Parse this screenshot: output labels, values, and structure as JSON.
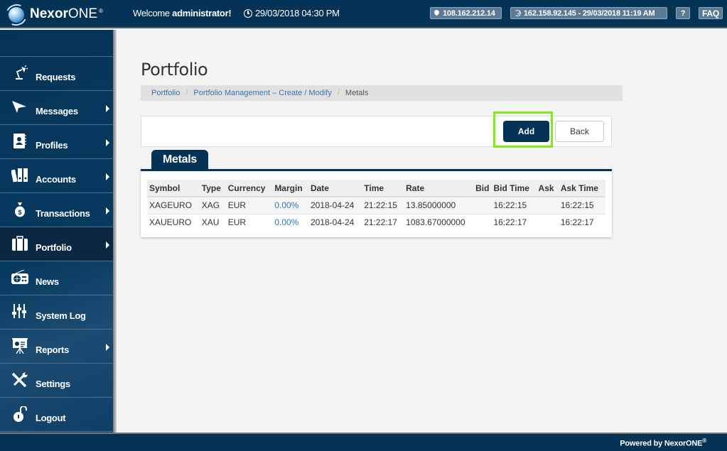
{
  "header": {
    "brand_bold": "Nexor",
    "brand_light": "ONE",
    "brand_mark": "®",
    "welcome_prefix": "Welcome ",
    "welcome_user": "administrator!",
    "datetime": "29/03/2018 04:30 PM",
    "ip_address": "108.162.212.14",
    "last_login": "162.158.92.145 - 29/03/2018 11:19 AM",
    "help_label": "?",
    "faq_label": "FAQ"
  },
  "sidebar": {
    "items": [
      {
        "label": "Requests",
        "icon": "desk-lamp-icon",
        "has_submenu": false
      },
      {
        "label": "Messages",
        "icon": "paper-plane-icon",
        "has_submenu": true
      },
      {
        "label": "Profiles",
        "icon": "address-book-icon",
        "has_submenu": true
      },
      {
        "label": "Accounts",
        "icon": "binders-icon",
        "has_submenu": true
      },
      {
        "label": "Transactions",
        "icon": "money-bag-icon",
        "has_submenu": true
      },
      {
        "label": "Portfolio",
        "icon": "briefcase-icon",
        "has_submenu": true,
        "active": true
      },
      {
        "label": "News",
        "icon": "radio-icon",
        "has_submenu": false
      },
      {
        "label": "System Log",
        "icon": "sliders-icon",
        "has_submenu": false
      },
      {
        "label": "Reports",
        "icon": "presentation-icon",
        "has_submenu": true
      },
      {
        "label": "Settings",
        "icon": "tools-icon",
        "has_submenu": false
      },
      {
        "label": "Logout",
        "icon": "unlock-icon",
        "has_submenu": false
      }
    ]
  },
  "main": {
    "title": "Portfolio",
    "breadcrumb": [
      {
        "label": "Portfolio",
        "link": true
      },
      {
        "label": "Portfolio Management – Create / Modify",
        "link": true
      },
      {
        "label": "Metals",
        "link": false
      }
    ],
    "breadcrumb_separator": "/",
    "actions": {
      "add_label": "Add",
      "back_label": "Back"
    },
    "tab_label": "Metals",
    "table": {
      "columns": [
        "Symbol",
        "Type",
        "Currency",
        "Margin",
        "Date",
        "Time",
        "Rate",
        "Bid",
        "Bid Time",
        "Ask",
        "Ask Time"
      ],
      "rows": [
        [
          "XAGEURO",
          "XAG",
          "EUR",
          "0.00%",
          "2018-04-24",
          "21:22:15",
          "13.85000000",
          "",
          "16:22:15",
          "",
          "16:22:15"
        ],
        [
          "XAUEURO",
          "XAU",
          "EUR",
          "0.00%",
          "2018-04-24",
          "21:22:17",
          "1083.67000000",
          "",
          "16:22:17",
          "",
          "16:22:17"
        ]
      ]
    }
  },
  "footer": {
    "text": "Powered by NexorONE",
    "mark": "®"
  },
  "colors": {
    "primary": "#053356",
    "link": "#3375b5",
    "highlight": "#7fec1a"
  }
}
